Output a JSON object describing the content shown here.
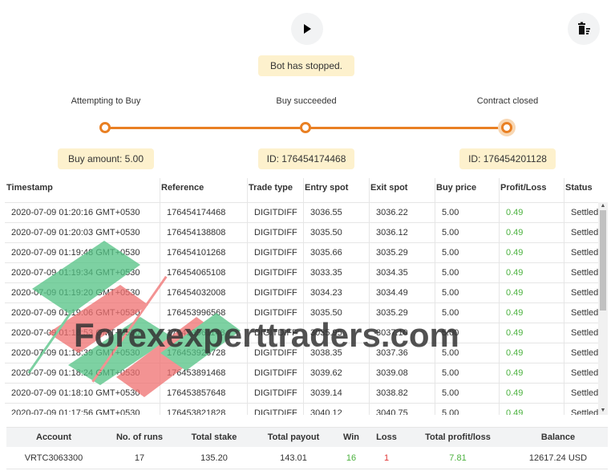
{
  "status": "Bot has stopped.",
  "steps": [
    {
      "label": "Attempting to Buy",
      "info": "Buy amount: 5.00"
    },
    {
      "label": "Buy succeeded",
      "info": "ID: 176454174468"
    },
    {
      "label": "Contract closed",
      "info": "ID: 176454201128"
    }
  ],
  "table": {
    "columns": [
      "Timestamp",
      "Reference",
      "Trade type",
      "Entry spot",
      "Exit spot",
      "Buy price",
      "Profit/Loss",
      "Status"
    ],
    "rows": [
      [
        "2020-07-09 01:20:16 GMT+0530",
        "176454174468",
        "DIGITDIFF",
        "3036.55",
        "3036.22",
        "5.00",
        "0.49",
        "Settled"
      ],
      [
        "2020-07-09 01:20:03 GMT+0530",
        "176454138808",
        "DIGITDIFF",
        "3035.50",
        "3036.12",
        "5.00",
        "0.49",
        "Settled"
      ],
      [
        "2020-07-09 01:19:48 GMT+0530",
        "176454101268",
        "DIGITDIFF",
        "3035.66",
        "3035.29",
        "5.00",
        "0.49",
        "Settled"
      ],
      [
        "2020-07-09 01:19:34 GMT+0530",
        "176454065108",
        "DIGITDIFF",
        "3033.35",
        "3034.35",
        "5.00",
        "0.49",
        "Settled"
      ],
      [
        "2020-07-09 01:19:20 GMT+0530",
        "176454032008",
        "DIGITDIFF",
        "3034.23",
        "3034.49",
        "5.00",
        "0.49",
        "Settled"
      ],
      [
        "2020-07-09 01:19:06 GMT+0530",
        "176453996568",
        "DIGITDIFF",
        "3035.50",
        "3035.29",
        "5.00",
        "0.49",
        "Settled"
      ],
      [
        "2020-07-09 01:18:53 GMT+0530",
        "176453961148",
        "DIGITDIFF",
        "3035.95",
        "3037.10",
        "5.00",
        "0.49",
        "Settled"
      ],
      [
        "2020-07-09 01:18:39 GMT+0530",
        "176453926728",
        "DIGITDIFF",
        "3038.35",
        "3037.36",
        "5.00",
        "0.49",
        "Settled"
      ],
      [
        "2020-07-09 01:18:24 GMT+0530",
        "176453891468",
        "DIGITDIFF",
        "3039.62",
        "3039.08",
        "5.00",
        "0.49",
        "Settled"
      ],
      [
        "2020-07-09 01:18:10 GMT+0530",
        "176453857648",
        "DIGITDIFF",
        "3039.14",
        "3038.82",
        "5.00",
        "0.49",
        "Settled"
      ],
      [
        "2020-07-09 01:17:56 GMT+0530",
        "176453821828",
        "DIGITDIFF",
        "3040.12",
        "3040.75",
        "5.00",
        "0.49",
        "Settled"
      ]
    ]
  },
  "summary": {
    "headers": [
      "Account",
      "No. of runs",
      "Total stake",
      "Total payout",
      "Win",
      "Loss",
      "Total profit/loss",
      "Balance"
    ],
    "values": [
      "VRTC3063300",
      "17",
      "135.20",
      "143.01",
      "16",
      "1",
      "7.81",
      "12617.24 USD"
    ]
  },
  "watermark": "Forexexperttraders.com",
  "colors": {
    "accent": "#e98024",
    "pill": "#fdf1cd",
    "profit": "#4bb13e",
    "loss": "#e03434"
  },
  "icons": {
    "play": "play-icon",
    "clear": "trash-list-icon"
  }
}
